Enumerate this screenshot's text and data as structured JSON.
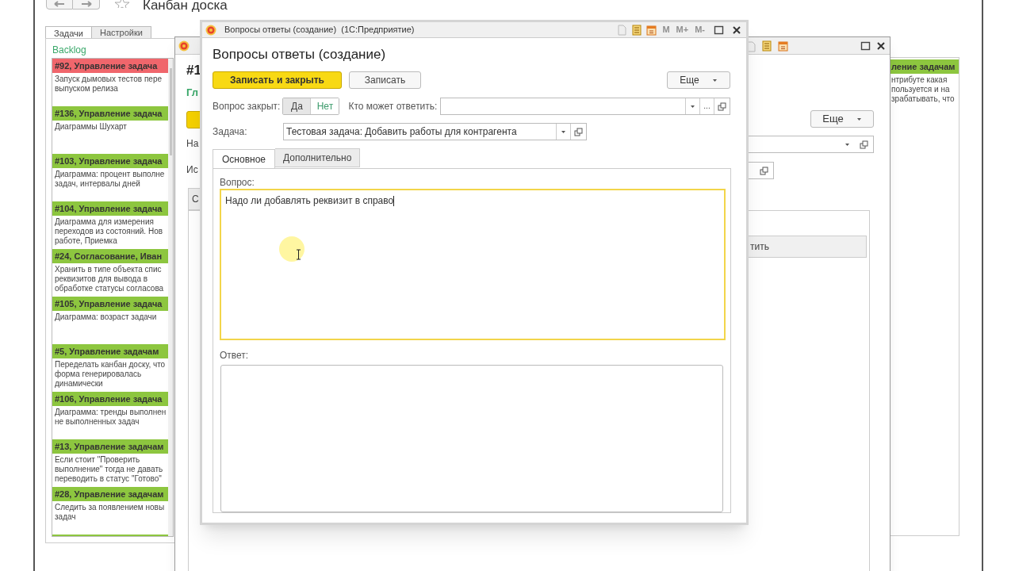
{
  "app": {
    "title": "Канбан доска",
    "tabs": [
      {
        "label": "Задачи",
        "selected": true
      },
      {
        "label": "Настройки",
        "selected": false
      }
    ],
    "column_title": "Backlog",
    "cards": [
      {
        "title": "#92, Управление задача",
        "color": "#f0666c",
        "text": "Запуск дымовых тестов пере\nвыпуском релиза"
      },
      {
        "title": "#136, Управление задача",
        "color": "#8dc63f",
        "text": "Диаграммы Шухарт"
      },
      {
        "title": "#103, Управление задача",
        "color": "#8dc63f",
        "text": "Диаграмма: процент выполне\nзадач, интервалы дней"
      },
      {
        "title": "#104, Управление задача",
        "color": "#8dc63f",
        "text": "Диаграмма для измерения\nпереходов из состояний. Нов\nработе, Приемка"
      },
      {
        "title": "#24, Согласование, Иван",
        "color": "#8dc63f",
        "text": "Хранить в типе объекта спис\nреквизитов для вывода в\nобработке статусы согласова"
      },
      {
        "title": "#105, Управление задача",
        "color": "#8dc63f",
        "text": "Диаграмма: возраст задачи"
      },
      {
        "title": "#5, Управление задачам",
        "color": "#8dc63f",
        "text": "Переделать канбан доску, что\nформа генерировалась\nдинамически"
      },
      {
        "title": "#106, Управление задача",
        "color": "#8dc63f",
        "text": "Диаграмма: тренды выполнен\nне выполненных задач"
      },
      {
        "title": "#13, Управление задачам",
        "color": "#8dc63f",
        "text": "Если стоит \"Проверить\nвыполнение\" тогда не давать\nпереводить в статус \"Готово\""
      },
      {
        "title": "#28, Управление задачам",
        "color": "#8dc63f",
        "text": "Следить за появлением новы\nзадач"
      }
    ],
    "right_card": {
      "title": "ление задачам",
      "text": "нтрибуте какая\nпользуется и на\nзрабатывать, что"
    }
  },
  "background_window": {
    "heading": "#1",
    "subtitle": "Гл",
    "label_1": "На",
    "label_2": "Ис",
    "tab": "С",
    "more_button": "Еще",
    "column_header": "тить"
  },
  "dialog": {
    "window_title": "Вопросы ответы (создание)  (1С:Предприятие)",
    "title_buttons": [
      {
        "label": "M",
        "disabled": true
      },
      {
        "label": "M+",
        "disabled": true
      },
      {
        "label": "M-",
        "disabled": true
      }
    ],
    "heading": "Вопросы ответы (создание)",
    "buttons": [
      {
        "label": "Записать и закрыть",
        "kind": "primary"
      },
      {
        "label": "Записать",
        "kind": "normal"
      }
    ],
    "more_button": "Еще",
    "closed_label": "Вопрос закрыт:",
    "closed_options": [
      {
        "label": "Да",
        "selected": true
      },
      {
        "label": "Нет",
        "selected": false
      }
    ],
    "answerer_label": "Кто может ответить:",
    "choose_button": "...",
    "task_label": "Задача:",
    "task_value": "Тестовая задача: Добавить работы для контрагента",
    "tabs": [
      {
        "label": "Основное",
        "selected": true
      },
      {
        "label": "Дополнительно",
        "selected": false
      }
    ],
    "question_label": "Вопрос:",
    "question_value": "Надо ли добавлять реквизит в справо",
    "answer_label": "Ответ:"
  }
}
